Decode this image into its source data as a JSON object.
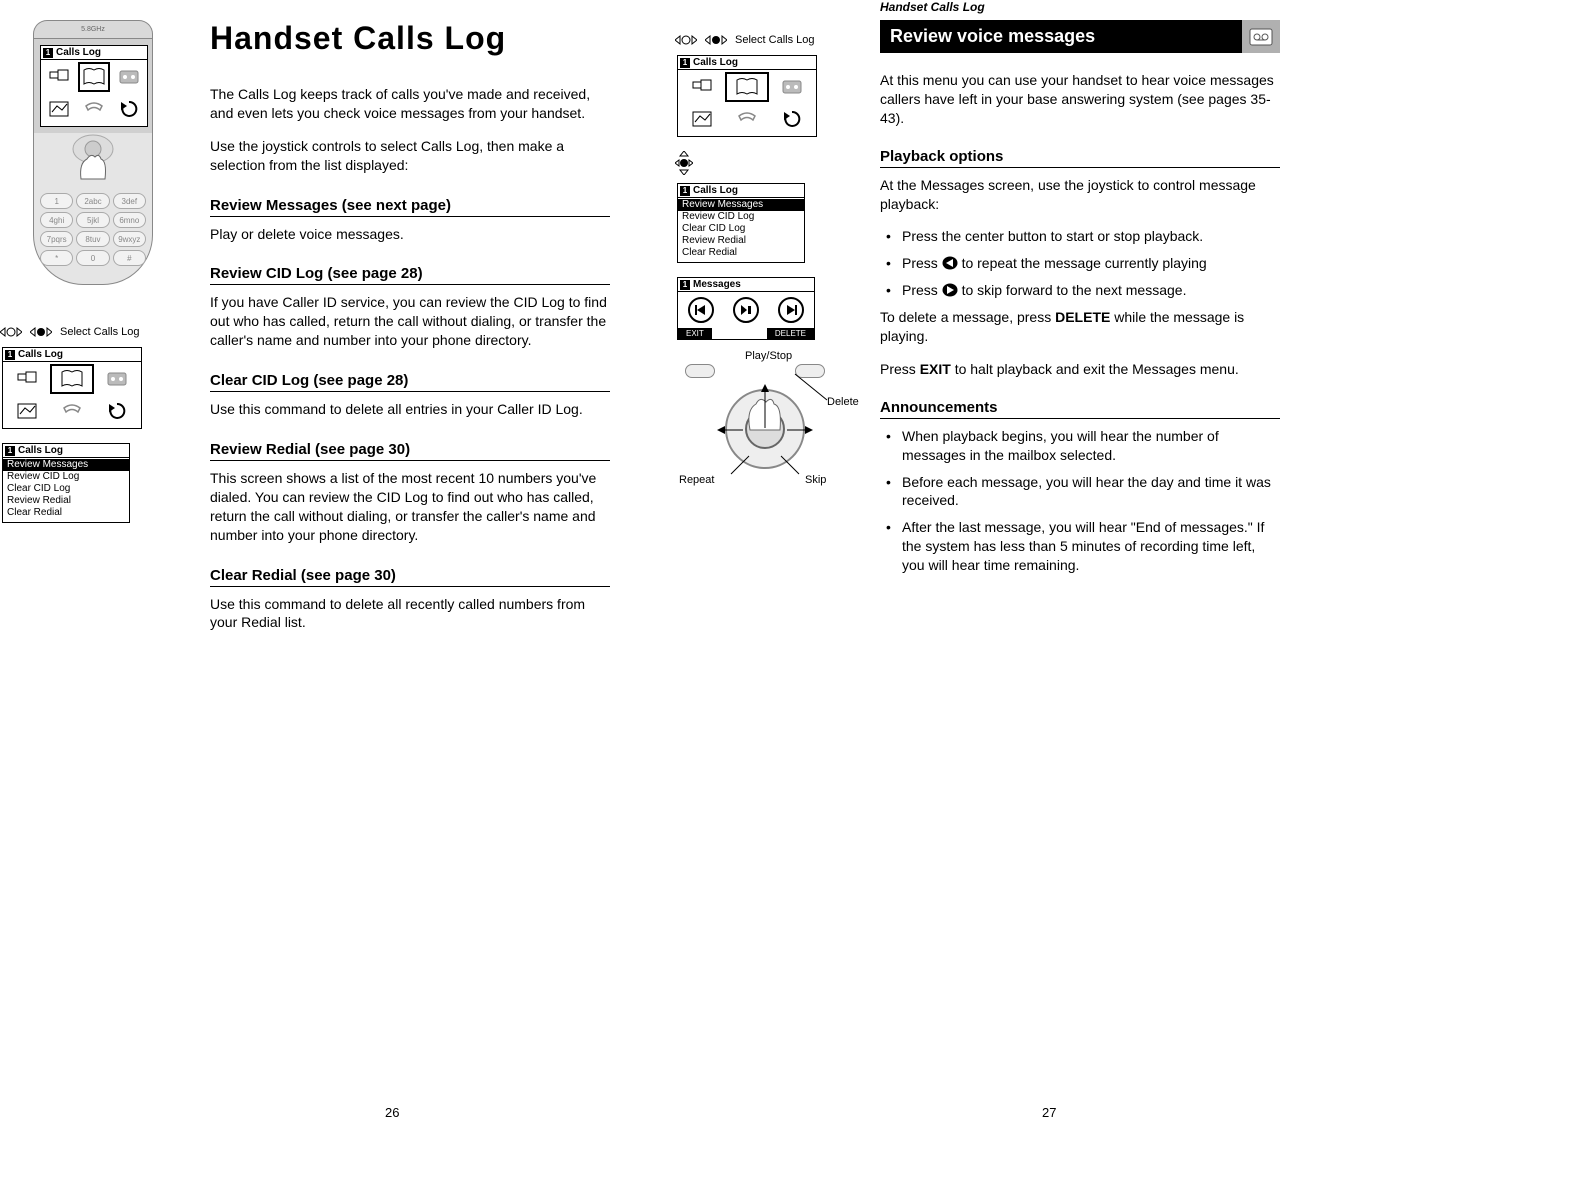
{
  "left_page": {
    "title": "Handset Calls Log",
    "intro1": "The Calls Log keeps track of calls you've made and received, and even lets you check voice messages from your handset.",
    "intro2": "Use the joystick controls to select Calls Log, then make a selection from the list displayed:",
    "sections": [
      {
        "heading": "Review Messages (see next page)",
        "body": "Play or delete voice messages."
      },
      {
        "heading": "Review CID Log (see page 28)",
        "body": "If you have Caller ID service, you can review the CID Log to find out who has called, return the call without dialing, or transfer the caller's name and number into your phone directory."
      },
      {
        "heading": "Clear CID Log (see page 28)",
        "body": "Use this command to delete all entries in your Caller ID Log."
      },
      {
        "heading": "Review Redial (see page 30)",
        "body": "This screen shows a list of the most recent 10 numbers you've dialed. You can review the CID Log to find out who has called, return the call without dialing, or transfer the caller's name and number into your phone directory."
      },
      {
        "heading": "Clear Redial (see page 30)",
        "body": "Use this command to delete all recently called numbers from your Redial list."
      }
    ],
    "page_number": "26"
  },
  "right_page": {
    "running_header": "Handset Calls Log",
    "banner": "Review voice messages",
    "intro": "At this menu you can use your handset to hear voice messages callers have left in your base answering system (see pages 35-43).",
    "playback_heading": "Playback options",
    "playback_intro": "At the Messages screen, use the joystick to control message playback:",
    "playback_items": [
      "Press the center button to start or stop playback.",
      "Press ◄ to repeat the message currently playing",
      "Press ► to skip forward to the next message."
    ],
    "delete_line_pre": "To delete a message, press ",
    "delete_bold": "DELETE",
    "delete_line_post": " while the message is playing.",
    "exit_line_pre": "Press ",
    "exit_bold": "EXIT",
    "exit_line_post": " to halt playback and exit the Messages menu.",
    "ann_heading": "Announcements",
    "ann_items": [
      "When playback begins, you will hear the number of messages in the mailbox selected.",
      "Before each message, you will hear the day and time it was received.",
      "After the last message, you will hear \"End of messages.\" If the system has less than 5 minutes of recording time left, you will hear time remaining."
    ],
    "page_number": "27"
  },
  "illus": {
    "select_label": "Select Calls Log",
    "calls_log_title": "Calls Log",
    "messages_title": "Messages",
    "menu_items": [
      "Review Messages",
      "Review CID Log",
      "Clear CID Log",
      "Review Redial",
      "Clear Redial"
    ],
    "exit": "EXIT",
    "delete": "DELETE",
    "play_stop": "Play/Stop",
    "repeat": "Repeat",
    "skip": "Skip",
    "delete_lbl": "Delete",
    "phone_band": "5.8GHz",
    "keypad": [
      "1",
      "2abc",
      "3def",
      "4ghi",
      "5jkl",
      "6mno",
      "7pqrs",
      "8tuv",
      "9wxyz",
      "*",
      "0",
      "#"
    ]
  }
}
